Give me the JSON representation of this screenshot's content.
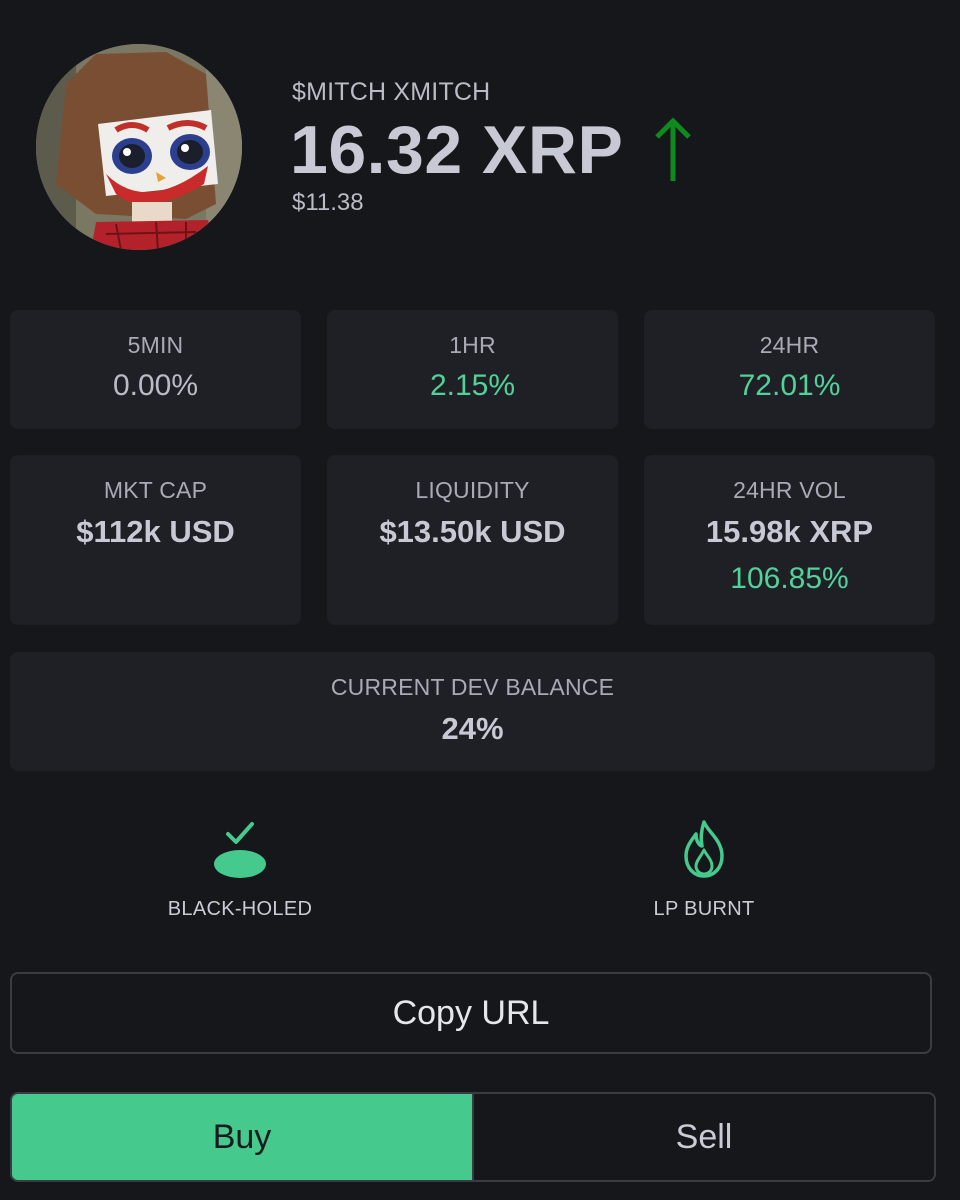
{
  "token": {
    "name": "$MITCH XMITCH",
    "price": "16.32 XRP",
    "usd_price": "$11.38",
    "trend_icon": "arrow-up-icon",
    "trend_color": "#0f8a1c"
  },
  "changes": [
    {
      "label": "5MIN",
      "value": "0.00%"
    },
    {
      "label": "1HR",
      "value": "2.15%"
    },
    {
      "label": "24HR",
      "value": "72.01%"
    }
  ],
  "stats": {
    "market_cap": {
      "label": "MKT CAP",
      "value": "$112k USD"
    },
    "liquidity": {
      "label": "LIQUIDITY",
      "value": "$13.50k USD"
    },
    "volume": {
      "label": "24HR VOL",
      "value": "15.98k XRP",
      "change": "106.85%"
    }
  },
  "dev_balance": {
    "label": "CURRENT DEV BALANCE",
    "value": "24%"
  },
  "status": {
    "black_holed": {
      "label": "BLACK-HOLED",
      "icon": "black-hole-check-icon"
    },
    "lp_burnt": {
      "label": "LP BURNT",
      "icon": "flame-icon"
    }
  },
  "actions": {
    "copy_url": "Copy URL",
    "buy": "Buy",
    "sell": "Sell"
  },
  "colors": {
    "background": "#16171b",
    "card": "#1f2025",
    "accent_green": "#45c98c",
    "positive_text": "#52d19a"
  }
}
